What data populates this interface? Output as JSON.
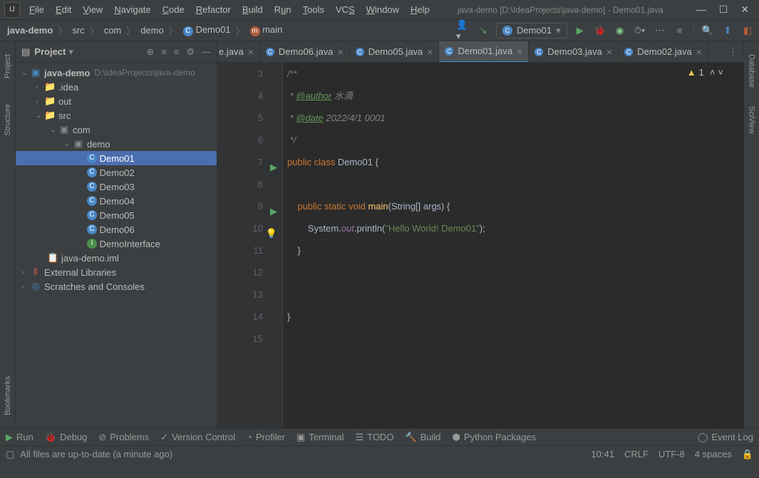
{
  "title": "java-demo [D:\\IdeaProjects\\java-demo] - Demo01.java",
  "menu": [
    "File",
    "Edit",
    "View",
    "Navigate",
    "Code",
    "Refactor",
    "Build",
    "Run",
    "Tools",
    "VCS",
    "Window",
    "Help"
  ],
  "breadcrumb": {
    "items": [
      "java-demo",
      "src",
      "com",
      "demo",
      "Demo01",
      "main"
    ]
  },
  "run_config": "Demo01",
  "project_panel": {
    "title": "Project"
  },
  "tree": {
    "root": {
      "name": "java-demo",
      "path": "D:\\IdeaProjects\\java-demo"
    },
    "idea": ".idea",
    "out": "out",
    "src": "src",
    "com": "com",
    "demo": "demo",
    "files": [
      "Demo01",
      "Demo02",
      "Demo03",
      "Demo04",
      "Demo05",
      "Demo06"
    ],
    "interface": "DemoInterface",
    "iml": "java-demo.iml",
    "ext": "External Libraries",
    "scratch": "Scratches and Consoles"
  },
  "tabs": [
    {
      "label": "e.java",
      "partial": true
    },
    {
      "label": "Demo06.java"
    },
    {
      "label": "Demo05.java"
    },
    {
      "label": "Demo01.java",
      "active": true
    },
    {
      "label": "Demo03.java"
    },
    {
      "label": "Demo02.java"
    }
  ],
  "warning_count": "1",
  "code": {
    "lines": [
      {
        "n": "3"
      },
      {
        "n": "4"
      },
      {
        "n": "5"
      },
      {
        "n": "6"
      },
      {
        "n": "7"
      },
      {
        "n": "8"
      },
      {
        "n": "9"
      },
      {
        "n": "10"
      },
      {
        "n": "11"
      },
      {
        "n": "12"
      },
      {
        "n": "13"
      },
      {
        "n": "14"
      },
      {
        "n": "15"
      }
    ],
    "author_tag": "@author",
    "author_val": " 水滴",
    "date_tag": "@date",
    "date_val": " 2022/4/1 0001",
    "class_name": "Demo01",
    "method": "main",
    "string": "\"Hello World! Demo01\""
  },
  "bottom_tools": [
    "Run",
    "Debug",
    "Problems",
    "Version Control",
    "Profiler",
    "Terminal",
    "TODO",
    "Build",
    "Python Packages"
  ],
  "event_log": "Event Log",
  "status": {
    "msg": "All files are up-to-date (a minute ago)",
    "time": "10:41",
    "sep": "CRLF",
    "enc": "UTF-8",
    "indent": "4 spaces"
  },
  "side_tabs_left": [
    "Project",
    "Structure",
    "Bookmarks"
  ],
  "side_tabs_right": [
    "Database",
    "SciView"
  ]
}
